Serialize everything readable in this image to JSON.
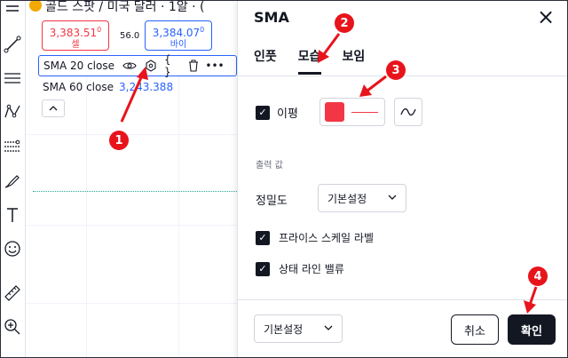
{
  "chart": {
    "symbol_title": "골드 스팟 / 미국 달러 · 1알 · (",
    "sell": {
      "price": "3,383.51",
      "price_sup": "0",
      "label": "셀"
    },
    "spread": "56.0",
    "buy": {
      "price": "3,384.07",
      "price_sup": "0",
      "label": "바이"
    },
    "indicator1": {
      "label": "SMA 20 close"
    },
    "indicator2": {
      "label": "SMA 60 close",
      "value": "3,243.388"
    },
    "colors": {
      "sell": "#f23645",
      "buy": "#2962ff",
      "dotted_line": "#26a69a"
    }
  },
  "toolbar": {
    "icons": [
      "menu-icon",
      "trend-line-icon",
      "horizontal-lines-icon",
      "pattern-icon",
      "fib-icon",
      "brush-icon",
      "text-icon",
      "emoji-icon",
      "ruler-icon",
      "zoom-in-icon"
    ]
  },
  "dialog": {
    "title": "SMA",
    "tabs": [
      {
        "label": "인풋",
        "active": false
      },
      {
        "label": "모습",
        "active": true
      },
      {
        "label": "보임",
        "active": false
      }
    ],
    "average_label": "이평",
    "average_checked": true,
    "line_color": "#f23645",
    "output_section_label": "출력 값",
    "precision_label": "정밀도",
    "precision_value": "기본설정",
    "price_scale_label": "프라이스 스케일 라벨",
    "price_scale_checked": true,
    "status_line_label": "상태 라인 밸류",
    "status_line_checked": true,
    "defaults_value": "기본설정",
    "cancel_label": "취소",
    "ok_label": "확인"
  },
  "annotations": {
    "markers": [
      "1",
      "2",
      "3",
      "4"
    ],
    "color": "#e8141c"
  }
}
